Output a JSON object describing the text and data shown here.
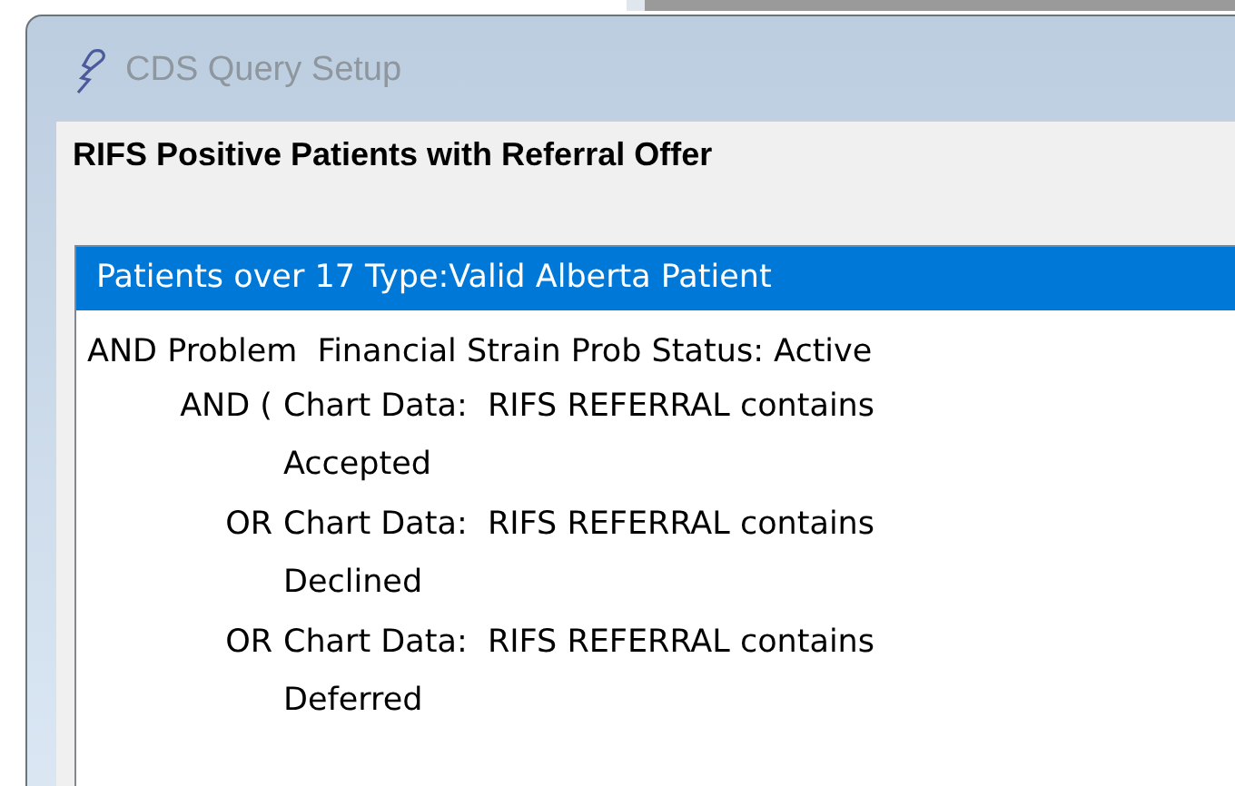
{
  "window": {
    "title": "CDS Query Setup"
  },
  "query_name": "RIFS Positive Patients with Referral Offer",
  "criteria": [
    {
      "kind": "base",
      "selected": true,
      "text": "Patients over 17 Type:Valid Alberta Patient"
    },
    {
      "kind": "condition",
      "selected": false,
      "text": "AND Problem  Financial Strain Prob Status: Active",
      "children": [
        {
          "operator": "AND (",
          "lines": [
            "Chart Data:  RIFS REFERRAL contains",
            "Accepted"
          ]
        },
        {
          "operator": "OR",
          "lines": [
            "Chart Data:  RIFS REFERRAL contains",
            "Declined"
          ]
        },
        {
          "operator": "OR",
          "lines": [
            "Chart Data:  RIFS REFERRAL contains",
            "Deferred"
          ]
        }
      ]
    }
  ]
}
